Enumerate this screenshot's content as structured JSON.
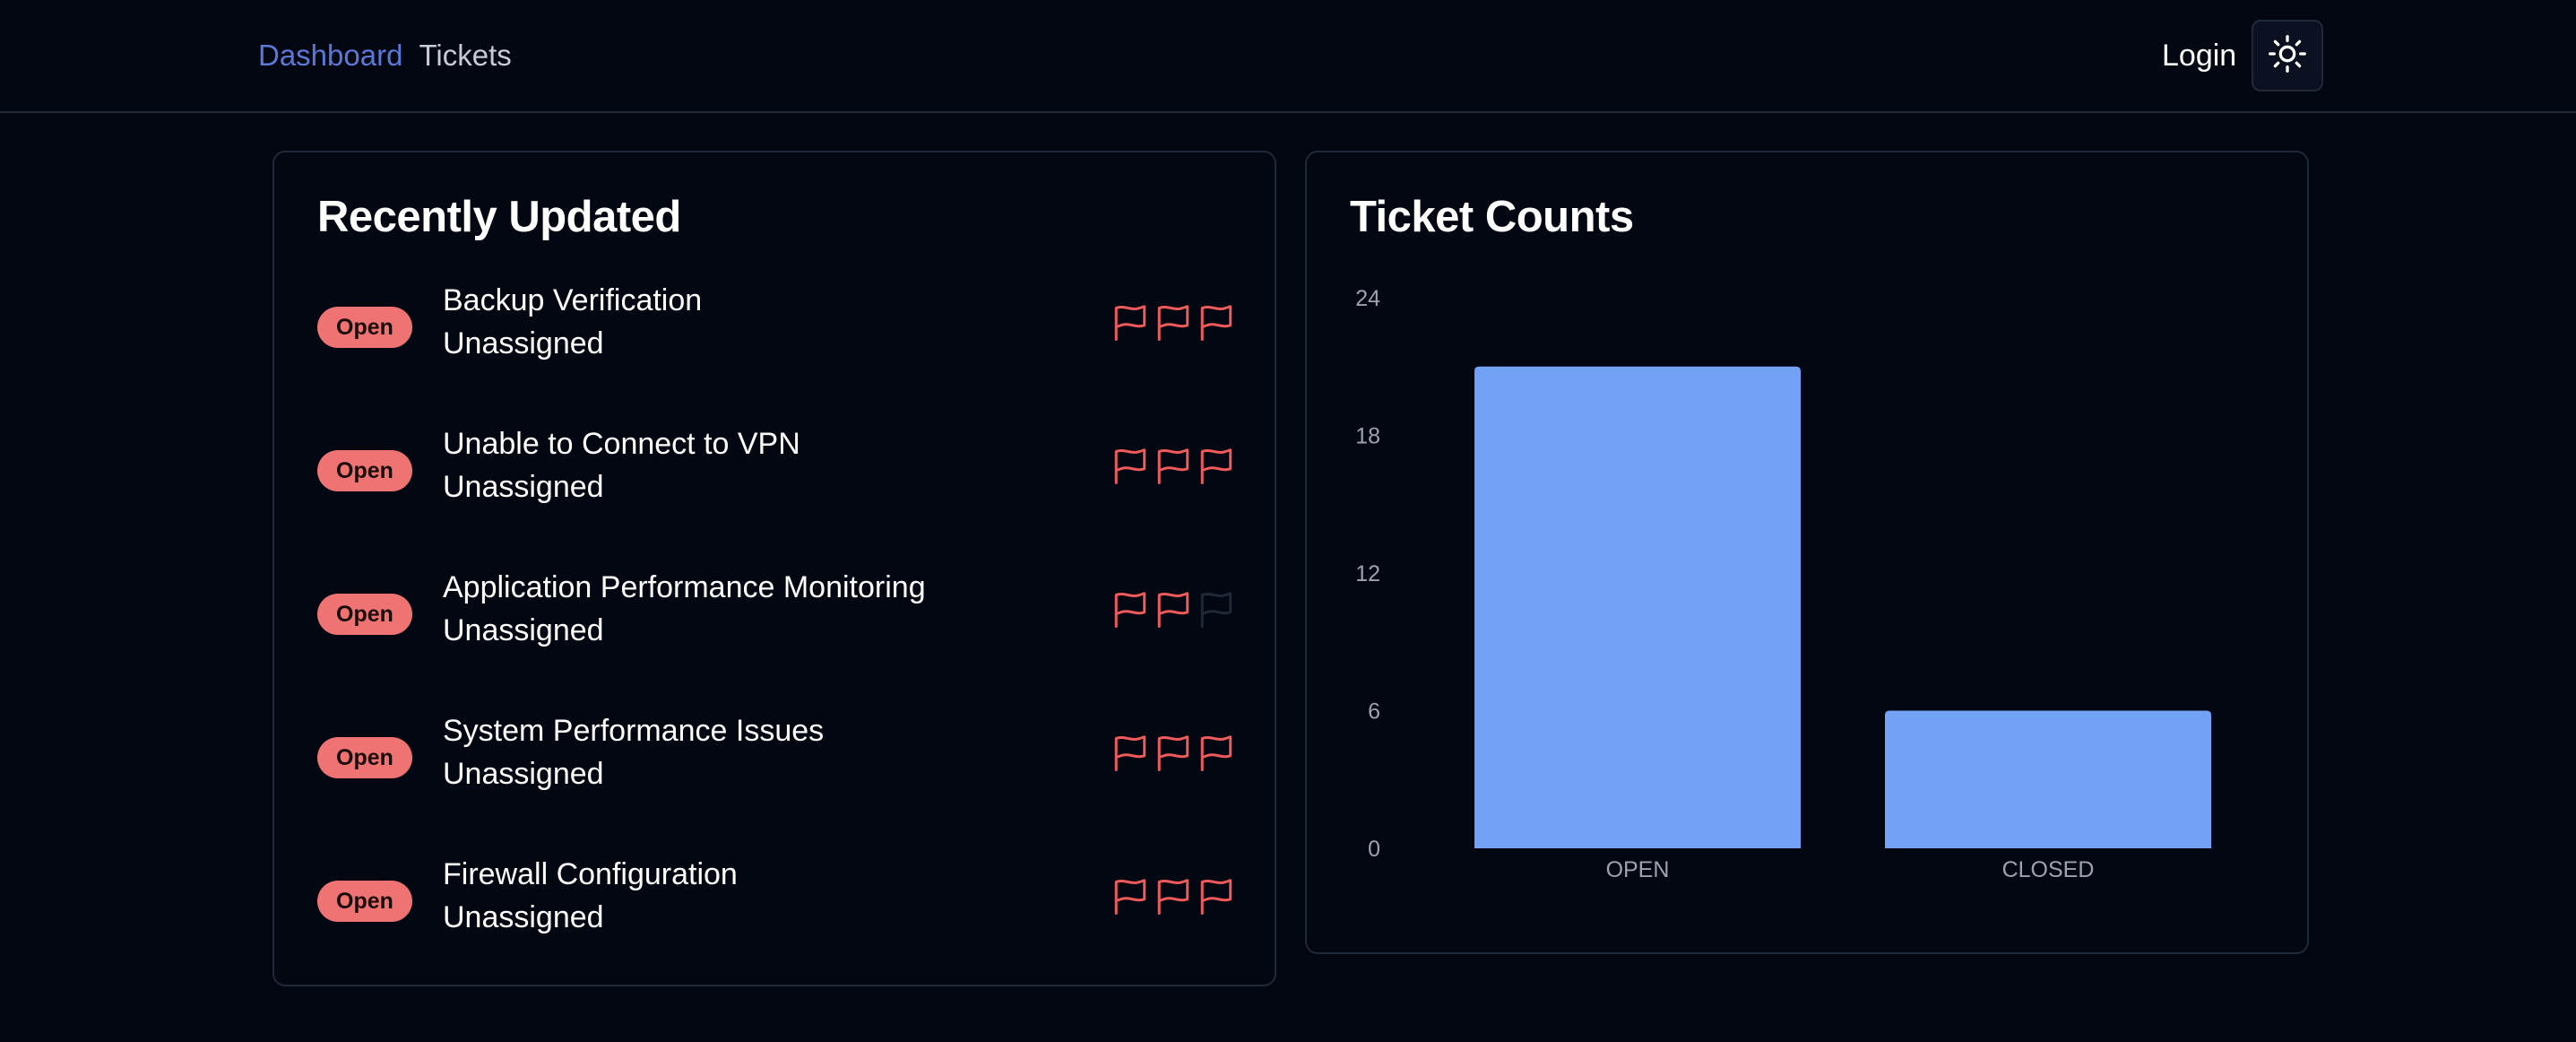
{
  "nav": {
    "dashboard_label": "Dashboard",
    "tickets_label": "Tickets",
    "login_label": "Login",
    "theme_icon": "sun-icon",
    "active_color": "#5b78d6"
  },
  "recent": {
    "title": "Recently Updated",
    "tickets": [
      {
        "status": "Open",
        "title": "Backup Verification",
        "assignee": "Unassigned",
        "priority": 3
      },
      {
        "status": "Open",
        "title": "Unable to Connect to VPN",
        "assignee": "Unassigned",
        "priority": 3
      },
      {
        "status": "Open",
        "title": "Application Performance Monitoring",
        "assignee": "Unassigned",
        "priority": 2
      },
      {
        "status": "Open",
        "title": "System Performance Issues",
        "assignee": "Unassigned",
        "priority": 3
      },
      {
        "status": "Open",
        "title": "Firewall Configuration",
        "assignee": "Unassigned",
        "priority": 3
      }
    ],
    "flag_icon": "flag-icon",
    "flag_on_color": "#ef5a5a",
    "flag_off_color": "#1f2937",
    "badge_color": "#f07373"
  },
  "counts": {
    "title": "Ticket Counts"
  },
  "chart_data": {
    "type": "bar",
    "categories": [
      "OPEN",
      "CLOSED"
    ],
    "values": [
      21,
      6
    ],
    "ylim": [
      0,
      24
    ],
    "yticks": [
      "0",
      "6",
      "12",
      "18",
      "24"
    ],
    "grid": false,
    "bar_color": "#72a1f5"
  }
}
